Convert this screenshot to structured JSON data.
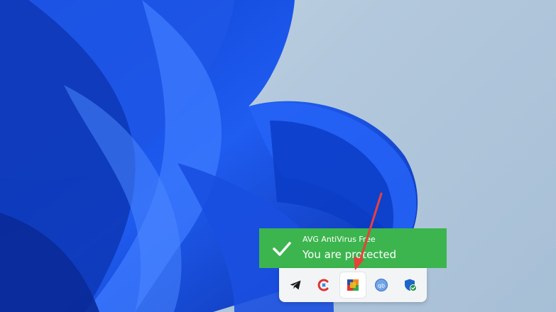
{
  "notification": {
    "app_name": "AVG AntiVirus Free",
    "message": "You are protected",
    "color": "#3cb54e"
  },
  "tray": {
    "icons": [
      {
        "name": "telegram-icon"
      },
      {
        "name": "ccleaner-icon"
      },
      {
        "name": "avg-icon"
      },
      {
        "name": "qbittorrent-icon"
      },
      {
        "name": "windows-security-icon"
      }
    ]
  },
  "annotation": {
    "arrow_color": "#e8413a"
  }
}
